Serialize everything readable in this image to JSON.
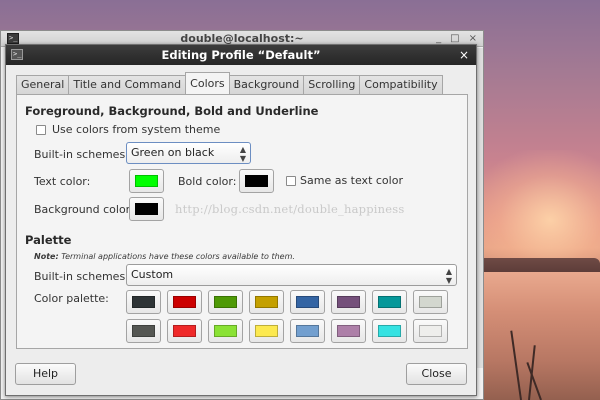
{
  "terminal_window": {
    "title": "double@localhost:~",
    "controls": [
      "_",
      "□",
      "×"
    ]
  },
  "dialog": {
    "title": "Editing Profile “Default”",
    "close_glyph": "×"
  },
  "tabs": [
    {
      "label": "General",
      "active": false
    },
    {
      "label": "Title and Command",
      "active": false
    },
    {
      "label": "Colors",
      "active": true
    },
    {
      "label": "Background",
      "active": false
    },
    {
      "label": "Scrolling",
      "active": false
    },
    {
      "label": "Compatibility",
      "active": false
    }
  ],
  "colors_section": {
    "heading": "Foreground, Background, Bold and Underline",
    "use_system_theme_label": "Use colors from system theme",
    "use_system_theme_checked": false,
    "builtin_label": "Built-in schemes:",
    "builtin_value": "Green on black",
    "text_color_label": "Text color:",
    "text_color": "#00ff00",
    "bold_color_label": "Bold color:",
    "bold_color": "#000000",
    "same_as_text_label": "Same as text color",
    "same_as_text_checked": false,
    "background_color_label": "Background color:",
    "background_color": "#000000",
    "watermark": "http://blog.csdn.net/double_happiness"
  },
  "palette_section": {
    "heading": "Palette",
    "note_bold": "Note:",
    "note_text": "Terminal applications have these colors available to them.",
    "builtin_label": "Built-in schemes:",
    "builtin_value": "Custom",
    "palette_label": "Color palette:",
    "colors": [
      [
        "#2e3436",
        "#cc0000",
        "#4e9a06",
        "#c4a000",
        "#3465a4",
        "#75507b",
        "#06989a",
        "#d3d7cf"
      ],
      [
        "#555753",
        "#ef2929",
        "#8ae234",
        "#fce94f",
        "#729fcf",
        "#ad7fa8",
        "#34e2e2",
        "#eeeeec"
      ]
    ]
  },
  "buttons": {
    "help": "Help",
    "close": "Close"
  },
  "icons": {
    "terminal": "terminal-icon",
    "combo_arrows": "up-down-arrows-icon"
  }
}
